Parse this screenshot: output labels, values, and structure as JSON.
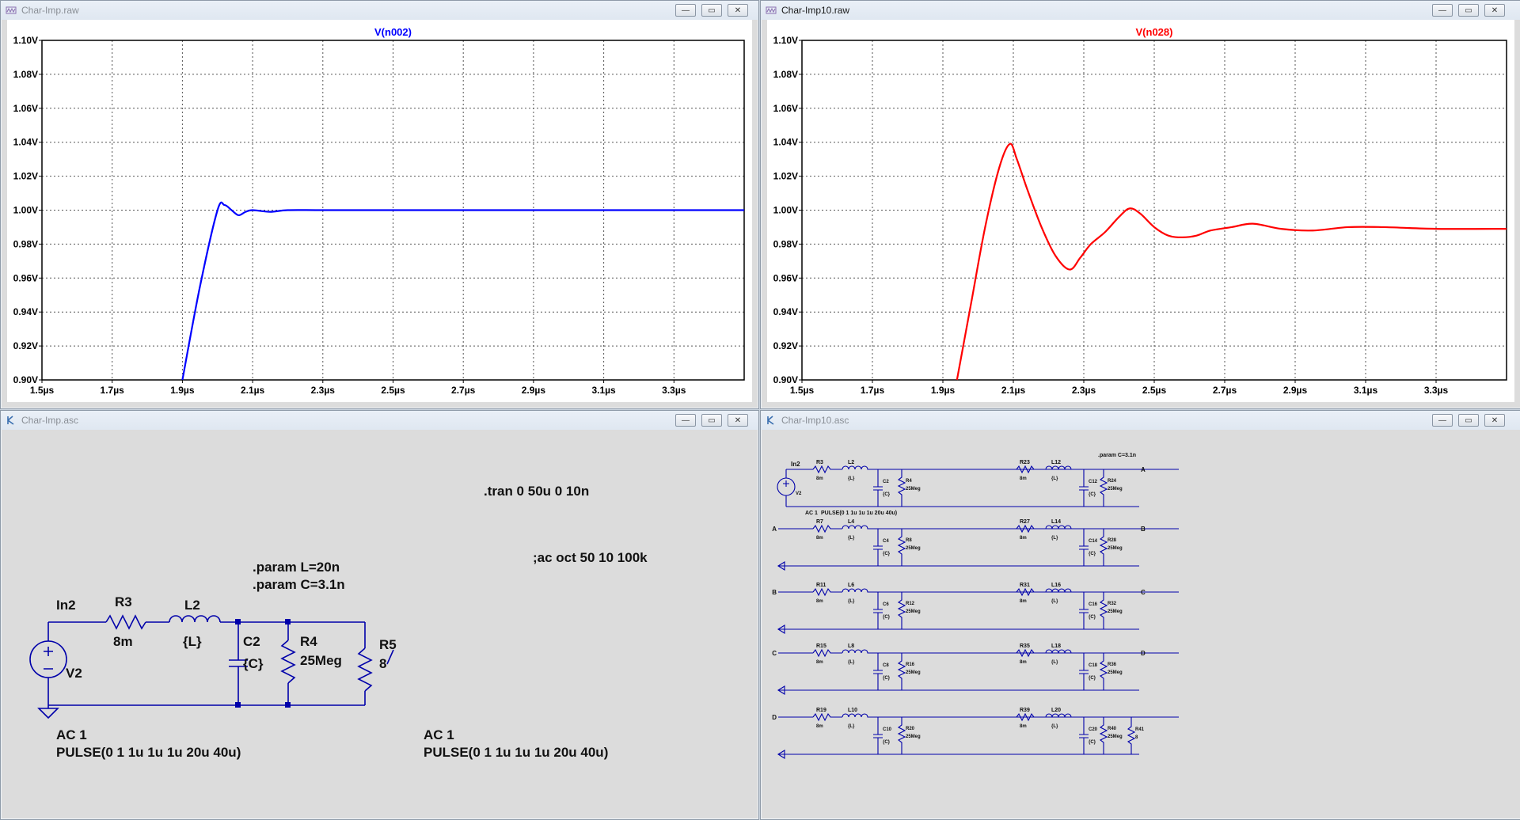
{
  "windows": {
    "wave1": {
      "title": "Char-Imp.raw",
      "trace_label": "V(n002)",
      "trace_color": "#0000ff"
    },
    "wave2": {
      "title": "Char-Imp10.raw",
      "trace_label": "V(n028)",
      "trace_color": "#ff0000"
    },
    "sch1": {
      "title": "Char-Imp.asc"
    },
    "sch2": {
      "title": "Char-Imp10.asc"
    }
  },
  "window_buttons": {
    "minimize": "—",
    "maximize": "▭",
    "close": "✕"
  },
  "plot": {
    "y_ticks": [
      "1.10V",
      "1.08V",
      "1.06V",
      "1.04V",
      "1.02V",
      "1.00V",
      "0.98V",
      "0.96V",
      "0.94V",
      "0.92V",
      "0.90V"
    ],
    "x_ticks": [
      "1.5µs",
      "1.7µs",
      "1.9µs",
      "2.1µs",
      "2.3µs",
      "2.5µs",
      "2.7µs",
      "2.9µs",
      "3.1µs",
      "3.3µs"
    ],
    "x_range_us": [
      1.5,
      3.5
    ],
    "y_range_v": [
      0.9,
      1.1
    ],
    "grid": "dotted"
  },
  "chart_data": [
    {
      "type": "line",
      "title": "V(n002)",
      "xlabel": "",
      "ylabel": "",
      "xlim": [
        1.5,
        3.5
      ],
      "ylim": [
        0.9,
        1.1
      ],
      "series": [
        {
          "name": "V(n002)",
          "x": [
            1.9,
            1.95,
            2.0,
            2.02,
            2.04,
            2.06,
            2.08,
            2.1,
            2.15,
            2.2,
            2.3,
            2.5,
            2.8,
            3.1,
            3.5
          ],
          "values": [
            0.9,
            0.955,
            1.0,
            1.003,
            1.0,
            0.997,
            0.999,
            1.0,
            0.999,
            1.0,
            1.0,
            1.0,
            1.0,
            1.0,
            1.0
          ]
        }
      ]
    },
    {
      "type": "line",
      "title": "V(n028)",
      "xlabel": "",
      "ylabel": "",
      "xlim": [
        1.5,
        3.5
      ],
      "ylim": [
        0.9,
        1.1
      ],
      "series": [
        {
          "name": "V(n028)",
          "x": [
            1.94,
            1.98,
            2.02,
            2.06,
            2.09,
            2.11,
            2.14,
            2.18,
            2.22,
            2.26,
            2.29,
            2.32,
            2.36,
            2.4,
            2.43,
            2.46,
            2.5,
            2.54,
            2.58,
            2.62,
            2.66,
            2.72,
            2.78,
            2.86,
            2.95,
            3.05,
            3.15,
            3.3,
            3.5
          ],
          "values": [
            0.9,
            0.945,
            0.99,
            1.025,
            1.039,
            1.03,
            1.012,
            0.99,
            0.973,
            0.965,
            0.972,
            0.98,
            0.987,
            0.996,
            1.001,
            0.998,
            0.99,
            0.985,
            0.984,
            0.985,
            0.988,
            0.99,
            0.992,
            0.989,
            0.988,
            0.99,
            0.99,
            0.989,
            0.989
          ]
        }
      ]
    }
  ],
  "sch1": {
    "tran": ".tran 0 50u 0 10n",
    "ac": ";ac oct 50 10 100k",
    "param1": ".param L=20n",
    "param2": ".param C=3.1n",
    "net_in": "In2",
    "r3": "R3",
    "r3v": "8m",
    "l2": "L2",
    "l2v": "{L}",
    "c2": "C2",
    "c2v": "{C}",
    "r4": "R4",
    "r4v": "25Meg",
    "r5": "R5",
    "r5v": "8",
    "v2": "V2",
    "ac_a": "AC 1",
    "pulse_a": "PULSE(0 1 1u 1u 1u 20u 40u)",
    "ac_b": "AC 1",
    "pulse_b": "PULSE(0 1 1u 1u 1u 20u 40u)"
  },
  "sch2": {
    "param": ".param C=3.1n",
    "in": "In2",
    "v2": "V2",
    "ac": "AC 1",
    "pulse": "PULSE(0 1 1u 1u 1u 20u 40u)",
    "rows": [
      {
        "left": "",
        "right": "A",
        "r1": "R3",
        "l1": "L2",
        "c1": "C2",
        "rs1": "R4",
        "r2": "R23",
        "l2": "L12",
        "c2": "C12",
        "rs2": "R24"
      },
      {
        "left": "A",
        "right": "B",
        "r1": "R7",
        "l1": "L4",
        "c1": "C4",
        "rs1": "R8",
        "r2": "R27",
        "l2": "L14",
        "c2": "C14",
        "rs2": "R28"
      },
      {
        "left": "B",
        "right": "C",
        "r1": "R11",
        "l1": "L6",
        "c1": "C6",
        "rs1": "R12",
        "r2": "R31",
        "l2": "L16",
        "c2": "C16",
        "rs2": "R32"
      },
      {
        "left": "C",
        "right": "D",
        "r1": "R15",
        "l1": "L8",
        "c1": "C8",
        "rs1": "R16",
        "r2": "R35",
        "l2": "L18",
        "c2": "C18",
        "rs2": "R36"
      },
      {
        "left": "D",
        "right": "",
        "r1": "R19",
        "l1": "L10",
        "c1": "C10",
        "rs1": "R20",
        "r2": "R39",
        "l2": "L20",
        "c2": "C20",
        "rs2": "R40"
      }
    ],
    "rv": "8m",
    "lv": "{L}",
    "cv": "{C}",
    "rsv": "25Meg",
    "r41": "R41",
    "r41v": "8"
  }
}
